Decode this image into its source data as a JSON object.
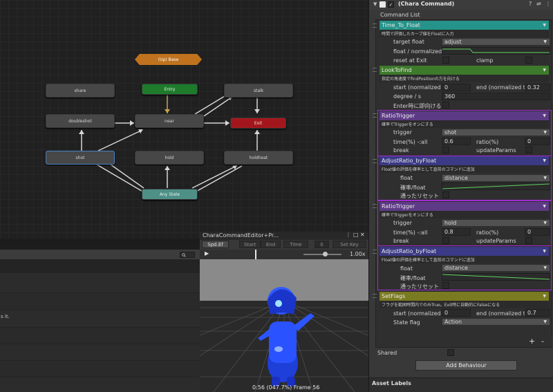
{
  "graph": {
    "base_label": "(Up) Base",
    "nodes": {
      "share": "share",
      "entry": "Entry",
      "stalk": "stalk",
      "doubleshot": "doubleshot",
      "near": "near",
      "exit": "Exit",
      "shot": "shot",
      "hold": "hold",
      "holdheat": "holdheat",
      "any_state": "Any State"
    }
  },
  "bottom_left": {
    "truncated_text": "s it."
  },
  "preview": {
    "title": "CharaCommandEditor+Pr...",
    "menu_icon": "kebab-icon",
    "max_icon": "maximize-icon",
    "close_icon": "close-icon",
    "toolbar": {
      "speed": "Spd.Ef",
      "start": "Start",
      "end": "End",
      "time": "Time",
      "time_value": "0",
      "set_key": "Set Key"
    },
    "speed_value": "1.00x",
    "status": "0:56 (047.7%) Frame 56"
  },
  "inspector": {
    "component_title": "(Chara Command)",
    "command_list_label": "Command List",
    "behaviours": [
      {
        "title": "Time_To_Float",
        "color": "#26938a",
        "desc": "時間で評価したカーブ値をFloatに入力",
        "rows": {
          "target_float_label": "target float",
          "target_float_value": "adjust",
          "float_norm_label": "float / normalizedTi",
          "reset_label": "reset at Exit",
          "clamp_label": "clamp"
        }
      },
      {
        "title": "LookToFind",
        "color": "#3d7a2b",
        "desc": "指定の角速度でfindPositionの方を向ける",
        "rows": {
          "start_label": "start (normalized tim",
          "start_value": "0",
          "end_label": "end (normalized tim",
          "end_value": "0.32",
          "degree_label": "degree / s",
          "degree_value": "360",
          "enter_label": "Enter時に即向ける"
        }
      },
      {
        "title": "RatioTrigger",
        "color": "#5d3a86",
        "desc": "確率でTriggerをオンにする",
        "rows": {
          "trigger_label": "trigger",
          "trigger_value": "shot",
          "time_label": "time(%) -:all",
          "time_value": "0.6",
          "ratio_label": "ratio(%)",
          "ratio_value": "0",
          "break_label": "break",
          "update_label": "updateParams"
        }
      },
      {
        "title": "AdjustRatio_byFloat",
        "color": "#3b3a86",
        "desc": "Float値の評価を確率として直前のコマンドに追加",
        "rows": {
          "float_label": "float",
          "float_value": "distance",
          "ratio_label": "確率/float",
          "reset_label": "通ったリセット"
        }
      },
      {
        "title": "RatioTrigger",
        "color": "#5d3a86",
        "desc": "確率でTriggerをオンにする",
        "rows": {
          "trigger_label": "trigger",
          "trigger_value": "hold",
          "time_label": "time(%) -:all",
          "time_value": "0.8",
          "ratio_label": "ratio(%)",
          "ratio_value": "0",
          "break_label": "break",
          "update_label": "updateParams"
        }
      },
      {
        "title": "AdjustRatio_byFloat",
        "color": "#3b3a86",
        "desc": "Float値の評価を確率として直前のコマンドに追加",
        "rows": {
          "float_label": "float",
          "float_value": "distance",
          "ratio_label": "確率/float",
          "reset_label": "通ったリセット"
        }
      },
      {
        "title": "SetFlags",
        "color": "#7a7a22",
        "desc": "フラグを範囲時間内でのみTrue。Exit時に自動的にFalseになる",
        "rows": {
          "start_label": "start (normalized tim",
          "start_value": "0",
          "end_label": "end (normalized tim",
          "end_value": "0.7",
          "state_label": "State flag",
          "state_value": "Action"
        }
      }
    ],
    "plus_label": "+",
    "minus_label": "-",
    "shared_label": "Shared",
    "add_behaviour_label": "Add Behaviour",
    "asset_labels": "Asset Labels"
  }
}
